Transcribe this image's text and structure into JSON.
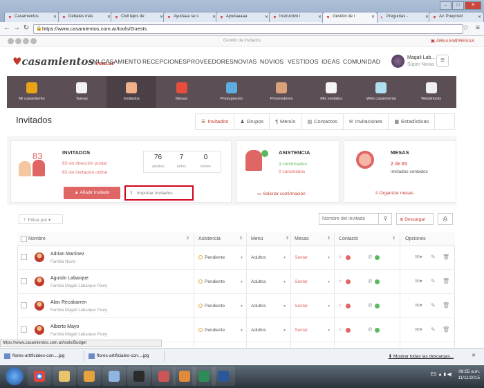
{
  "browser": {
    "tabs": [
      {
        "label": "Casamientos"
      },
      {
        "label": "Debates más"
      },
      {
        "label": "Civil lejos de"
      },
      {
        "label": "Ayudaaa se s"
      },
      {
        "label": "Ayudaaaaa"
      },
      {
        "label": "Instructivo i"
      },
      {
        "label": "Gestión de i"
      },
      {
        "label": "Preguntas -"
      },
      {
        "label": "Av. Pueyrred"
      }
    ],
    "url": "https://www.casamientos.com.ar/tools/Guests"
  },
  "site_bar": {
    "title": "Gestión de invitados",
    "area_empresas": "ÁREA EMPRESAS"
  },
  "header": {
    "logo_main": "casamientos",
    "logo_suffix": ".com.ar",
    "nav": [
      "MI CASAMIENTO",
      "RECEPCIONES",
      "PROVEEDORES",
      "NOVIAS",
      "NOVIOS",
      "VESTIDOS",
      "IDEAS",
      "COMUNIDAD"
    ],
    "user_name": "Magali Lab...",
    "user_role": "Súper Novia"
  },
  "categories": [
    {
      "label": "Mi casamiento",
      "color": "#e8a317"
    },
    {
      "label": "Tareas",
      "color": "#f2f2f2"
    },
    {
      "label": "Invitados",
      "color": "#f0b08a"
    },
    {
      "label": "Mesas",
      "color": "#e74c3c"
    },
    {
      "label": "Presupuesto",
      "color": "#5dade2"
    },
    {
      "label": "Proveedores",
      "color": "#d9a07a"
    },
    {
      "label": "Mis vestidos",
      "color": "#f4f4f4"
    },
    {
      "label": "Web casamiento",
      "color": "#aee0f0"
    },
    {
      "label": "Wedshoots",
      "color": "#f0f0f0"
    }
  ],
  "page": {
    "title": "Invitados",
    "view_tabs": [
      {
        "icon": "☰",
        "label": "Invitados"
      },
      {
        "icon": "♟",
        "label": "Grupos"
      },
      {
        "icon": "¶",
        "label": "Menús"
      },
      {
        "icon": "▤",
        "label": "Contactos"
      },
      {
        "icon": "✉",
        "label": "Invitaciones"
      },
      {
        "icon": "▦",
        "label": "Estadísticas"
      }
    ]
  },
  "guests_card": {
    "count": "83",
    "title": "INVITADOS",
    "no_address": "83 sin dirección postal",
    "no_invite": "83 sin invitación online",
    "adults": "76",
    "adults_label": "adultos",
    "kids": "7",
    "kids_label": "niños",
    "babies": "0",
    "babies_label": "bebés",
    "add_button": "Añadir invitado",
    "import_button": "Importar invitados"
  },
  "attendance_card": {
    "title": "ASISTENCIA",
    "confirmed": "3 confirmados",
    "cancelled": "0 cancelados",
    "action": "Solicitar confirmación"
  },
  "tables_card": {
    "title": "MESAS",
    "seated": "2 de 83",
    "seated_label": "invitados sentados",
    "action": "Organizar mesas"
  },
  "toolbar": {
    "filter": "Filtrar por",
    "search_placeholder": "Nombre del invitado",
    "download": "Descargar"
  },
  "table": {
    "headers": [
      "Nombre",
      "Asistencia",
      "Menú",
      "Mesas",
      "Contacto",
      "Opciones"
    ],
    "rows": [
      {
        "name": "Adrian Martinez",
        "group": "Familia Novio",
        "attendance": "Pendiente",
        "menu": "Adultos",
        "table": "Sentar"
      },
      {
        "name": "Agustin Labarque",
        "group": "Familia Magali Labarque Picey",
        "attendance": "Pendiente",
        "menu": "Adultos",
        "table": "Sentar"
      },
      {
        "name": "Alan Recabarren",
        "group": "Familia Magali Labarque Picey",
        "attendance": "Pendiente",
        "menu": "Adultos",
        "table": "Sentar"
      },
      {
        "name": "Alberto Mayo",
        "group": "Familia Magali Labarque Picey",
        "attendance": "Pendiente",
        "menu": "Adultos",
        "table": "Sentar"
      }
    ]
  },
  "status_bar": {
    "url": "https://www.casamientos.com.ar/tools/Budget"
  },
  "downloads": {
    "items": [
      "flores-artificiales-con....jpg",
      "flores-artificiales-con....jpg"
    ],
    "show_all": "Mostrar todas las descargas..."
  },
  "taskbar": {
    "lang": "ES",
    "time": "08:55 a.m.",
    "date": "11/11/2015"
  }
}
